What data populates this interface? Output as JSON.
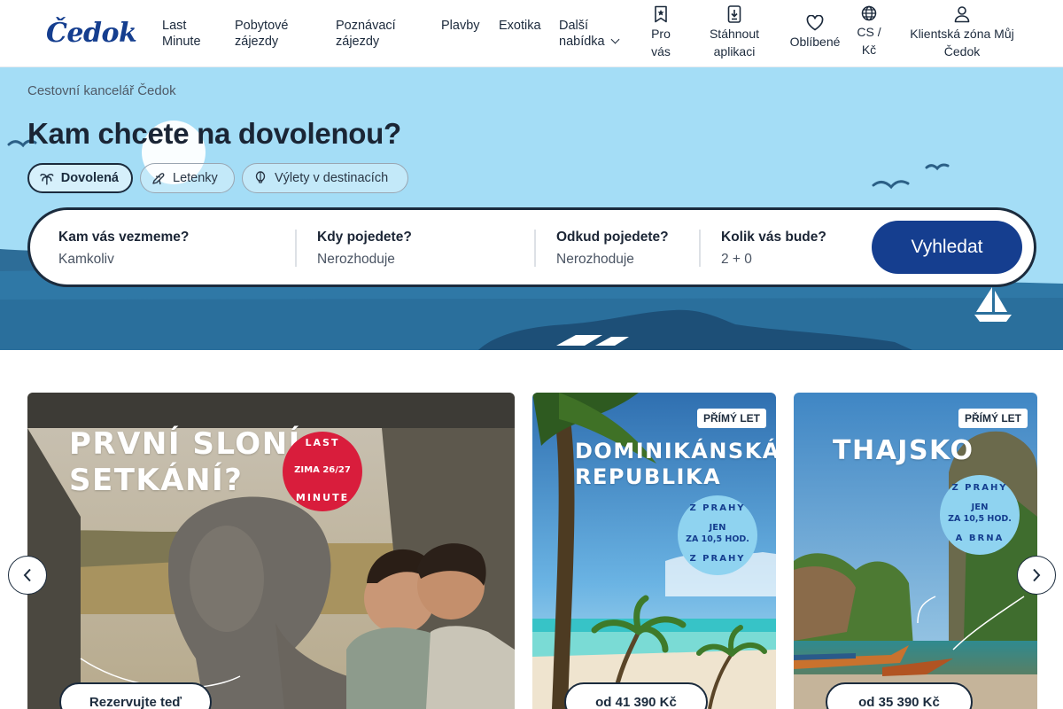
{
  "header": {
    "logo": "Čedok",
    "nav": [
      {
        "line1": "Last",
        "line2": "Minute"
      },
      {
        "line1": "Pobytové",
        "line2": "zájezdy"
      },
      {
        "line1": "Poznávací",
        "line2": "zájezdy"
      },
      {
        "line1": "Plavby",
        "line2": ""
      },
      {
        "line1": "Exotika",
        "line2": ""
      },
      {
        "line1": "Další",
        "line2": "nabídka"
      }
    ],
    "utils": [
      {
        "line1": "Pro",
        "line2": "vás",
        "icon": "bookmark-star-icon"
      },
      {
        "line1": "Stáhnout",
        "line2": "aplikaci",
        "icon": "download-phone-icon"
      },
      {
        "line1": "Oblíbené",
        "line2": "",
        "icon": "heart-icon"
      },
      {
        "line1": "CS /",
        "line2": "Kč",
        "icon": "globe-icon"
      },
      {
        "line1": "Klientská zóna Můj",
        "line2": "Čedok",
        "icon": "user-icon"
      }
    ]
  },
  "hero": {
    "breadcrumb": "Cestovní kancelář Čedok",
    "title": "Kam chcete na dovolenou?",
    "pills": [
      {
        "label": "Dovolená",
        "icon": "palm-tree-icon",
        "active": true
      },
      {
        "label": "Letenky",
        "icon": "plane-icon",
        "active": false
      },
      {
        "label": "Výlety v destinacích",
        "icon": "balloon-icon",
        "active": false
      }
    ],
    "search": {
      "fields": [
        {
          "label": "Kam vás vezmeme?",
          "value": "Kamkoliv"
        },
        {
          "label": "Kdy pojedete?",
          "value": "Nerozhoduje"
        },
        {
          "label": "Odkud pojedete?",
          "value": "Nerozhoduje"
        },
        {
          "label": "Kolik vás bude?",
          "value": "2 + 0"
        }
      ],
      "button": "Vyhledat"
    }
  },
  "cards": [
    {
      "title_line1": "První sloní",
      "title_line2": "setkání?",
      "badge_top": "LAST",
      "badge_mid": "ZIMA 26/27",
      "badge_bottom": "MINUTE",
      "button": "Rezervujte teď"
    },
    {
      "tag": "PŘÍMÝ LET",
      "title_line1": "Dominikánská",
      "title_line2": "republika",
      "badge_top": "Z PRAHY",
      "badge_mid1": "JEN",
      "badge_mid2": "ZA 10,5 HOD.",
      "badge_bottom": "Z PRAHY",
      "button": "od 41 390 Kč"
    },
    {
      "tag": "PŘÍMÝ LET",
      "title_line1": "Thajsko",
      "badge_top": "Z PRAHY",
      "badge_mid1": "JEN",
      "badge_mid2": "ZA 10,5 HOD.",
      "badge_bottom": "A BRNA",
      "button": "od 35 390 Kč"
    }
  ],
  "colors": {
    "brand": "#153e8f",
    "hero_sky": "#a4ddf6",
    "sea": "#2a6f9c",
    "badge_red": "#d91d3c",
    "badge_blue": "#8fd3f0"
  }
}
